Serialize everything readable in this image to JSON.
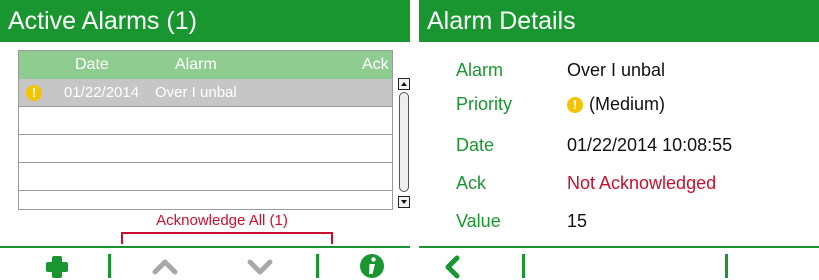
{
  "left": {
    "title": "Active Alarms  (1)",
    "columns": {
      "date": "Date",
      "alarm": "Alarm",
      "ack": "Ack"
    },
    "rows": [
      {
        "icon": "warning-icon",
        "date": "01/22/2014",
        "alarm": "Over I unbal",
        "ack": ""
      }
    ],
    "ack_all_label": "Acknowledge All  (1)"
  },
  "right": {
    "title": "Alarm Details",
    "details": {
      "alarm": {
        "label": "Alarm",
        "value": "Over I unbal"
      },
      "priority": {
        "label": "Priority",
        "value": "(Medium)"
      },
      "date": {
        "label": "Date",
        "value": "01/22/2014 10:08:55"
      },
      "ack": {
        "label": "Ack",
        "value": "Not Acknowledged"
      },
      "value": {
        "label": "Value",
        "value": "15"
      }
    }
  },
  "colors": {
    "green": "#1a9631",
    "light_green": "#8fcc8f",
    "red": "#c8102e",
    "yellow": "#f4c400",
    "gray": "#c6c6c6"
  }
}
